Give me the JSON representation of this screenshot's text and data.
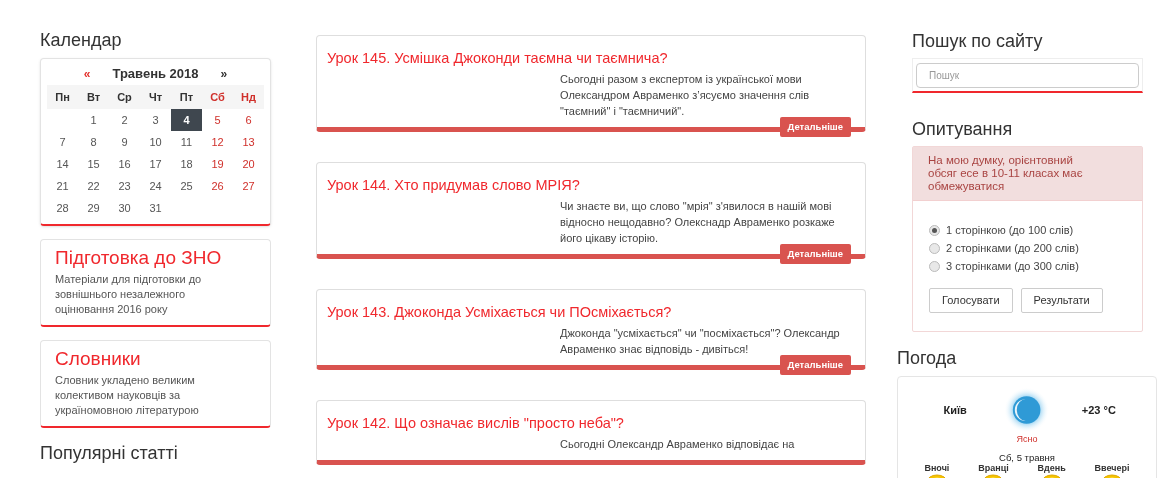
{
  "calendar": {
    "title": "Календар",
    "prev": "«",
    "month": "Травень 2018",
    "next": "»",
    "headers": [
      {
        "label": "Пн",
        "kind": "weekday"
      },
      {
        "label": "Вт",
        "kind": "weekday"
      },
      {
        "label": "Ср",
        "kind": "weekday"
      },
      {
        "label": "Чт",
        "kind": "weekday"
      },
      {
        "label": "Пт",
        "kind": "weekday"
      },
      {
        "label": "Сб",
        "kind": "weekend"
      },
      {
        "label": "Нд",
        "kind": "weekend"
      }
    ],
    "weeks": [
      {
        "days": [
          {
            "label": "1",
            "selected": false
          },
          {
            "label": "2",
            "selected": false
          },
          {
            "label": "3",
            "selected": false
          },
          {
            "label": "4",
            "selected": true
          },
          {
            "label": "5",
            "selected": false
          },
          {
            "label": "6",
            "selected": false
          }
        ]
      },
      {
        "days": [
          {
            "label": "7",
            "selected": false
          },
          {
            "label": "8",
            "selected": false
          },
          {
            "label": "9",
            "selected": false
          },
          {
            "label": "10",
            "selected": false
          },
          {
            "label": "11",
            "selected": false
          },
          {
            "label": "12",
            "selected": false
          },
          {
            "label": "13",
            "selected": false
          }
        ]
      },
      {
        "days": [
          {
            "label": "14",
            "selected": false
          },
          {
            "label": "15",
            "selected": false
          },
          {
            "label": "16",
            "selected": false
          },
          {
            "label": "17",
            "selected": false
          },
          {
            "label": "18",
            "selected": false
          },
          {
            "label": "19",
            "selected": false
          },
          {
            "label": "20",
            "selected": false
          }
        ]
      },
      {
        "days": [
          {
            "label": "21",
            "selected": false
          },
          {
            "label": "22",
            "selected": false
          },
          {
            "label": "23",
            "selected": false
          },
          {
            "label": "24",
            "selected": false
          },
          {
            "label": "25",
            "selected": false
          },
          {
            "label": "26",
            "selected": false
          },
          {
            "label": "27",
            "selected": false
          }
        ]
      },
      {
        "days": [
          {
            "label": "28",
            "selected": false
          },
          {
            "label": "29",
            "selected": false
          },
          {
            "label": "30",
            "selected": false
          },
          {
            "label": "31",
            "selected": false
          }
        ]
      }
    ]
  },
  "promos": [
    {
      "title": "Підготовка до ЗНО",
      "text": "Матеріали для підготовки до зовнішнього незалежного оцінювання 2016 року"
    },
    {
      "title": "Словники",
      "text": "Словник укладено великим колективом науковців за україномовною літературою"
    }
  ],
  "popular_title": "Популярні статті",
  "articles": [
    {
      "title": "Урок 145. Усмішка Джоконди таємна чи таємнича?",
      "text": "Сьогодні разом з експертом із української мови Олександром Авраменко з’ясуємо значення слів \"таємний\" і \"таємничий\".",
      "button": "Детальніше"
    },
    {
      "title": "Урок 144. Хто придумав слово МРІЯ?",
      "text": "Чи знаєте ви, що слово \"мрія\" з'явилося в нашій мові відносно нещодавно? Олекснадр Авраменко розкаже його цікаву історію.",
      "button": "Детальніше"
    },
    {
      "title": "Урок 143. Джоконда Усміхається чи ПОсміхається?",
      "text": "Джоконда \"усміхається\" чи \"посміхається\"? Олександр Авраменко знає відповідь - дивіться!",
      "button": "Детальніше"
    },
    {
      "title": "Урок 142. Що означає вислів \"просто неба\"?",
      "text": "Сьогодні Олександр Авраменко відповідає на"
    }
  ],
  "search": {
    "title": "Пошук по сайту",
    "placeholder": "Пошук"
  },
  "poll": {
    "title": "Опитування",
    "question": "На мою думку, орієнтовний обсяг есе в 10-11 класах має обмежуватися",
    "options": [
      {
        "label": "1 сторінкою (до 100 слів)",
        "selected": true
      },
      {
        "label": "2 сторінками (до 200 слів)",
        "selected": false
      },
      {
        "label": "3 сторінками (до 300 слів)",
        "selected": false
      }
    ],
    "buttons": [
      "Голосувати",
      "Результати"
    ]
  },
  "weather": {
    "title": "Погода",
    "city": "Київ",
    "temperature": "+23 °C",
    "condition": "Ясно",
    "date": "Сб, 5 травня",
    "periods": [
      {
        "label": "Вночі"
      },
      {
        "label": "Вранці"
      },
      {
        "label": "Вдень"
      },
      {
        "label": "Ввечері"
      }
    ]
  }
}
